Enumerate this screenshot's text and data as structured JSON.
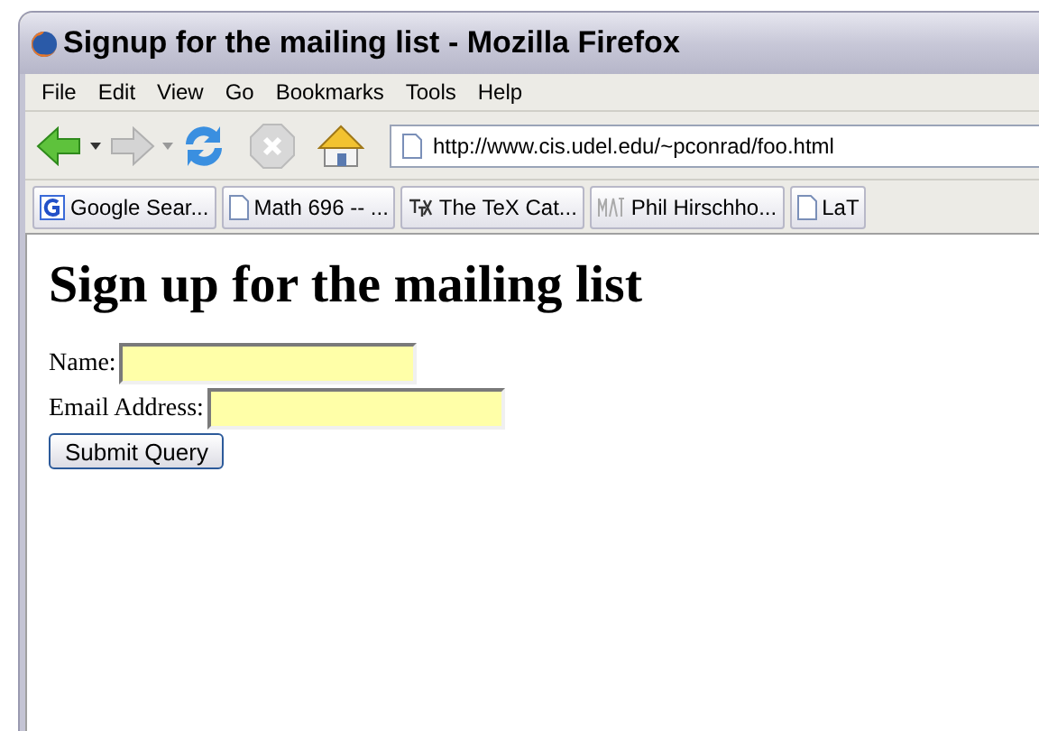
{
  "window": {
    "title": "Signup for the mailing list - Mozilla Firefox"
  },
  "menu": [
    "File",
    "Edit",
    "View",
    "Go",
    "Bookmarks",
    "Tools",
    "Help"
  ],
  "toolbar": {
    "url": "http://www.cis.udel.edu/~pconrad/foo.html"
  },
  "bookmarks": [
    {
      "kind": "google",
      "label": "Google Sear..."
    },
    {
      "kind": "page",
      "label": "Math 696 -- ..."
    },
    {
      "kind": "tex",
      "label": "The TeX Cat..."
    },
    {
      "kind": "math",
      "label": "Phil Hirschho..."
    },
    {
      "kind": "page",
      "label": "LaT"
    }
  ],
  "page": {
    "heading": "Sign up for the mailing list",
    "fields": [
      {
        "label": "Name:"
      },
      {
        "label": "Email Address:"
      }
    ],
    "button": "Submit Query"
  }
}
